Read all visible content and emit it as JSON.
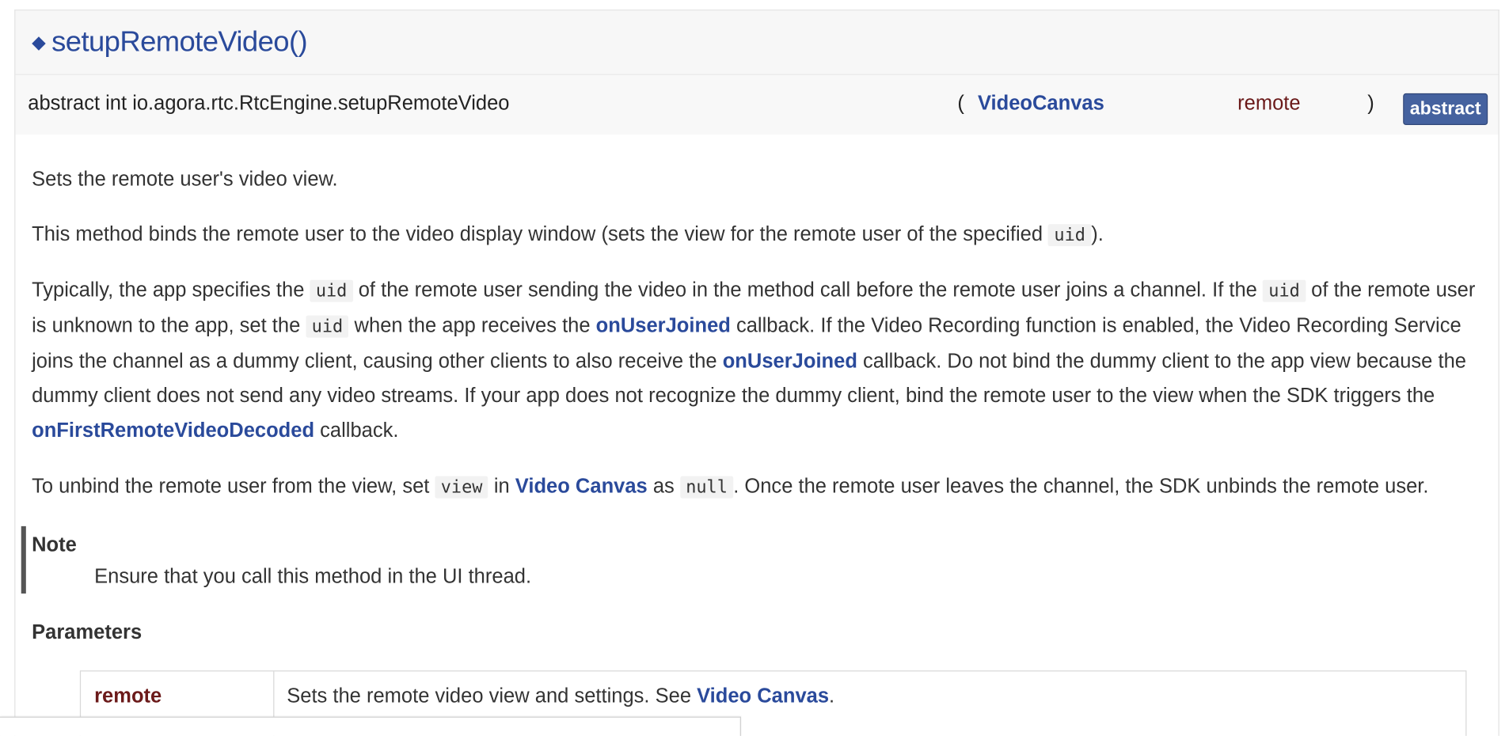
{
  "member": {
    "title": "setupRemoteVideo()",
    "prototype": {
      "name": "abstract int io.agora.rtc.RtcEngine.setupRemoteVideo",
      "open_paren": "(",
      "param_type": "VideoCanvas",
      "param_name": "remote",
      "close_paren": ")",
      "badge": "abstract"
    }
  },
  "doc": {
    "p1": "Sets the remote user's video view.",
    "p2": {
      "t1": "This method binds the remote user to the video display window (sets the view for the remote user of the specified ",
      "c1": "uid",
      "t2": ")."
    },
    "p3": {
      "t1": "Typically, the app specifies the ",
      "c1": "uid",
      "t2": " of the remote user sending the video in the method call before the remote user joins a channel. If the ",
      "c2": "uid",
      "t3": " of the remote user is unknown to the app, set the ",
      "c3": "uid",
      "t4": " when the app receives the ",
      "l1": "onUserJoined",
      "t5": " callback. If the Video Recording function is enabled, the Video Recording Service joins the channel as a dummy client, causing other clients to also receive the ",
      "l2": "onUserJoined",
      "t6": " callback. Do not bind the dummy client to the app view because the dummy client does not send any video streams. If your app does not recognize the dummy client, bind the remote user to the view when the SDK triggers the ",
      "l3": "onFirstRemoteVideoDecoded",
      "t7": " callback."
    },
    "p4": {
      "t1": "To unbind the remote user from the view, set ",
      "c1": "view",
      "t2": " in ",
      "l1": "Video Canvas",
      "t3": " as ",
      "c2": "null",
      "t4": ". Once the remote user leaves the channel, the SDK unbinds the remote user."
    },
    "note": {
      "title": "Note",
      "body": "Ensure that you call this method in the UI thread."
    },
    "parameters": {
      "heading": "Parameters",
      "rows": [
        {
          "name": "remote",
          "desc": "Sets the remote video view and settings. See ",
          "link": "Video Canvas",
          "tail": "."
        }
      ]
    }
  },
  "colors": {
    "link": "#2a4a9b",
    "param_name": "#6b1a1a",
    "badge_bg": "#45629f",
    "note_bar": "#555555"
  }
}
